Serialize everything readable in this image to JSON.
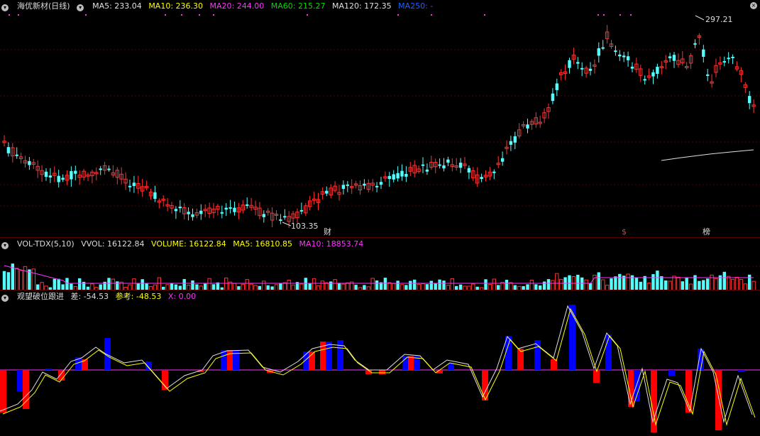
{
  "price_panel": {
    "stock_name": "海优新材(日线)",
    "ma5": "MA5: 233.04",
    "ma10": "MA10: 236.30",
    "ma20": "MA20: 244.00",
    "ma60": "MA60: 215.27",
    "ma120": "MA120: 172.35",
    "ma250": "MA250: -",
    "high_label": "297.21",
    "low_label": "103.35",
    "marker_cai": "财",
    "marker_s": "$",
    "marker_bang": "榜",
    "colors": {
      "ma5": "#e0e0e0",
      "ma10": "#ffff00",
      "ma20": "#ff33ff",
      "ma60": "#00dd00",
      "ma120": "#e0e0e0",
      "ma250": "#2060ff",
      "up": "#ff3232",
      "down": "#54ffff"
    }
  },
  "volume_panel": {
    "name": "VOL-TDX(5,10)",
    "vvol": "VVOL: 16122.84",
    "volume": "VOLUME: 16122.84",
    "ma5": "MA5: 16810.85",
    "ma10": "MA10: 18853.74"
  },
  "indicator_panel": {
    "name": "观望破位跟进",
    "diff": "差: -54.53",
    "ref": "参考: -48.53",
    "x": "X: 0.00",
    "colors": {
      "red": "#ff0000",
      "blue": "#0000ff"
    }
  }
}
